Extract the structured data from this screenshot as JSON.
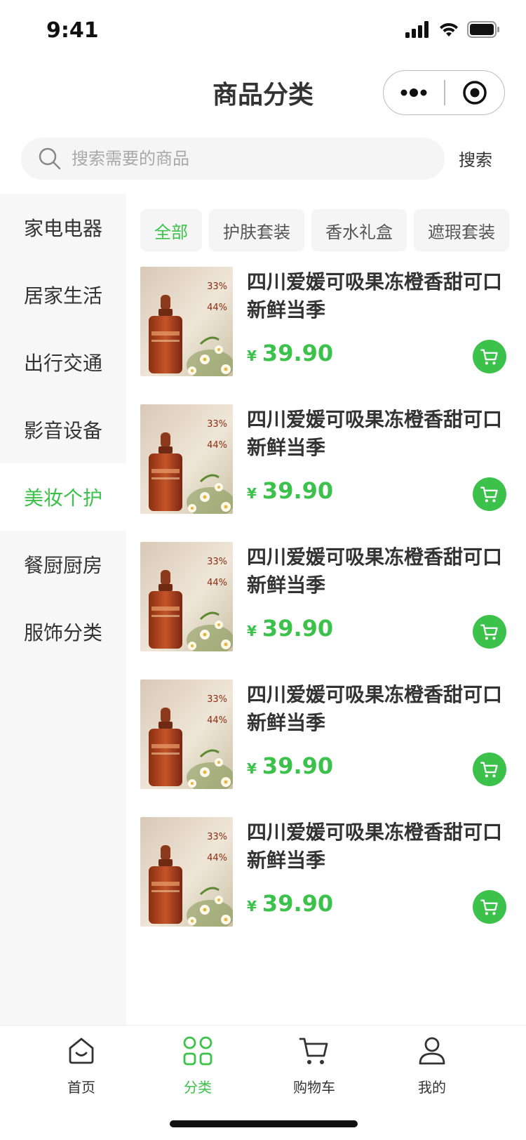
{
  "status_bar": {
    "time": "9:41"
  },
  "nav": {
    "title": "商品分类"
  },
  "search": {
    "placeholder": "搜索需要的商品",
    "button_label": "搜索"
  },
  "sidebar": {
    "items": [
      {
        "label": "家电电器"
      },
      {
        "label": "居家生活"
      },
      {
        "label": "出行交通"
      },
      {
        "label": "影音设备"
      },
      {
        "label": "美妆个护",
        "active": true
      },
      {
        "label": "餐厨厨房"
      },
      {
        "label": "服饰分类"
      }
    ]
  },
  "tabs": [
    {
      "label": "全部",
      "active": true
    },
    {
      "label": "护肤套装"
    },
    {
      "label": "香水礼盒"
    },
    {
      "label": "遮瑕套装"
    }
  ],
  "products": [
    {
      "name": "四川爱媛可吸果冻橙香甜可口新鲜当季",
      "currency": "¥",
      "price": "39.90",
      "image_text": {
        "pct1": "33",
        "pct2": "44",
        "unit": "%"
      }
    },
    {
      "name": "四川爱媛可吸果冻橙香甜可口新鲜当季",
      "currency": "¥",
      "price": "39.90",
      "image_text": {
        "pct1": "33",
        "pct2": "44",
        "unit": "%"
      }
    },
    {
      "name": "四川爱媛可吸果冻橙香甜可口新鲜当季",
      "currency": "¥",
      "price": "39.90",
      "image_text": {
        "pct1": "33",
        "pct2": "44",
        "unit": "%"
      }
    },
    {
      "name": "四川爱媛可吸果冻橙香甜可口新鲜当季",
      "currency": "¥",
      "price": "39.90",
      "image_text": {
        "pct1": "33",
        "pct2": "44",
        "unit": "%"
      }
    },
    {
      "name": "四川爱媛可吸果冻橙香甜可口新鲜当季",
      "currency": "¥",
      "price": "39.90",
      "image_text": {
        "pct1": "33",
        "pct2": "44",
        "unit": "%"
      }
    }
  ],
  "tab_bar": {
    "items": [
      {
        "label": "首页",
        "icon": "home-icon"
      },
      {
        "label": "分类",
        "icon": "category-icon",
        "active": true
      },
      {
        "label": "购物车",
        "icon": "cart-icon"
      },
      {
        "label": "我的",
        "icon": "user-icon"
      }
    ]
  },
  "colors": {
    "accent": "#3cc14a",
    "sidebar_bg": "#f7f7f7",
    "text": "#333333"
  }
}
